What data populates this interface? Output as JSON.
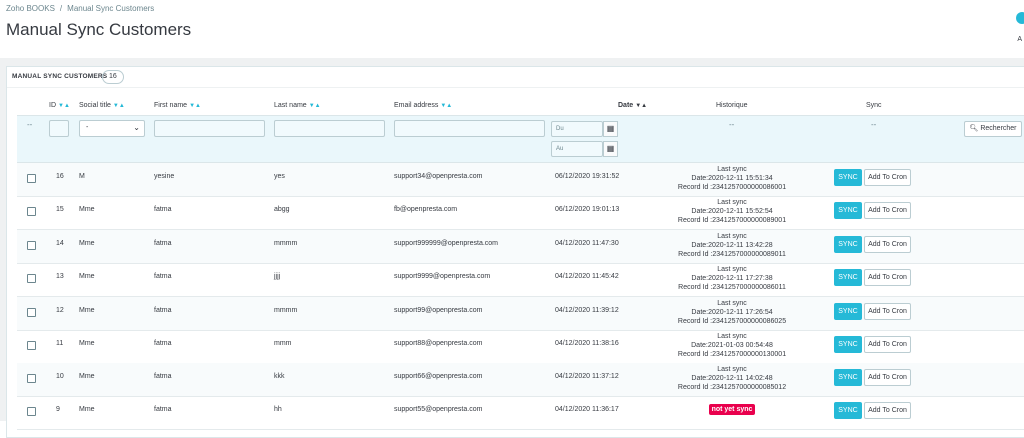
{
  "breadcrumb": {
    "root": "Zoho BOOKS",
    "separator": "/",
    "current": "Manual Sync Customers"
  },
  "page_title": "Manual Sync Customers",
  "corner_letter": "A",
  "panel": {
    "title": "MANUAL SYNC CUSTOMERS",
    "count": "16"
  },
  "columns": {
    "id": "ID",
    "social_title": "Social title",
    "first_name": "First name",
    "last_name": "Last name",
    "email": "Email address",
    "date": "Date",
    "historique": "Historique",
    "sync": "Sync"
  },
  "filters": {
    "dash": "--",
    "social_title_selected": "-",
    "date_from_placeholder": "Du",
    "date_to_placeholder": "Au",
    "search_label": "Rechercher"
  },
  "colors": {
    "accent": "#25b9d7",
    "danger": "#e9004d",
    "filter_bg": "#eaf7fb"
  },
  "icons": {
    "calendar": "calendar-icon",
    "search": "search-icon",
    "sort": "sort-arrows-icon"
  },
  "buttons": {
    "sync": "SYNC",
    "add_to_cron": "Add To Cron"
  },
  "rows": [
    {
      "id": "16",
      "title": "M",
      "first": "yesine",
      "last": "yes",
      "email": "support34@openpresta.com",
      "date": "06/12/2020 19:31:52",
      "hist": [
        "Last sync",
        "Date:2020-12-11 15:51:34",
        "Record Id :2341257000000086001"
      ]
    },
    {
      "id": "15",
      "title": "Mme",
      "first": "fatma",
      "last": "abgg",
      "email": "fb@openpresta.com",
      "date": "06/12/2020 19:01:13",
      "hist": [
        "Last sync",
        "Date:2020-12-11 15:52:54",
        "Record Id :2341257000000089001"
      ]
    },
    {
      "id": "14",
      "title": "Mme",
      "first": "fatma",
      "last": "mmmm",
      "email": "support999999@openpresta.com",
      "date": "04/12/2020 11:47:30",
      "hist": [
        "Last sync",
        "Date:2020-12-11 13:42:28",
        "Record Id :2341257000000089011"
      ]
    },
    {
      "id": "13",
      "title": "Mme",
      "first": "fatma",
      "last": "jjjj",
      "email": "support9999@openpresta.com",
      "date": "04/12/2020 11:45:42",
      "hist": [
        "Last sync",
        "Date:2020-12-11 17:27:38",
        "Record Id :2341257000000086011"
      ]
    },
    {
      "id": "12",
      "title": "Mme",
      "first": "fatma",
      "last": "mmmm",
      "email": "support99@openpresta.com",
      "date": "04/12/2020 11:39:12",
      "hist": [
        "Last sync",
        "Date:2020-12-11 17:26:54",
        "Record Id :2341257000000086025"
      ]
    },
    {
      "id": "11",
      "title": "Mme",
      "first": "fatma",
      "last": "mmm",
      "email": "support88@openpresta.com",
      "date": "04/12/2020 11:38:16",
      "hist": [
        "Last sync",
        "Date:2021-01-03 00:54:48",
        "Record Id :2341257000000130001"
      ]
    },
    {
      "id": "10",
      "title": "Mme",
      "first": "fatma",
      "last": "kkk",
      "email": "support66@openpresta.com",
      "date": "04/12/2020 11:37:12",
      "hist": [
        "Last sync",
        "Date:2020-12-11 14:02:48",
        "Record Id :2341257000000085012"
      ]
    },
    {
      "id": "9",
      "title": "Mme",
      "first": "fatma",
      "last": "hh",
      "email": "support55@openpresta.com",
      "date": "04/12/2020 11:36:17",
      "hist": [],
      "not_synced": "not yet sync"
    }
  ]
}
